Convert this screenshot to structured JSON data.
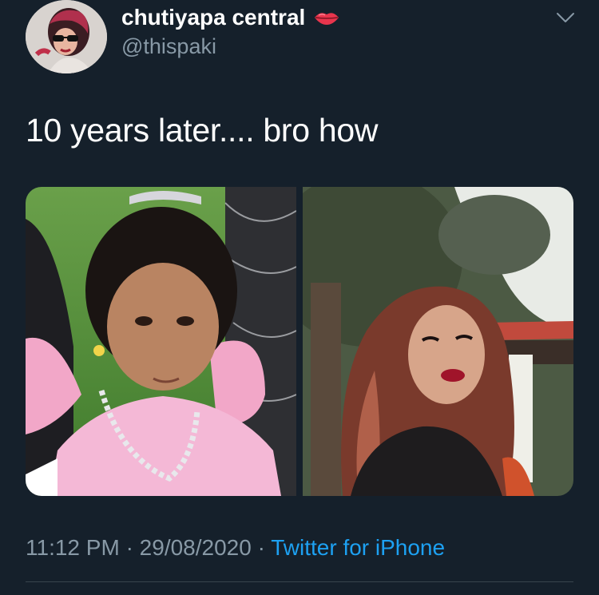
{
  "tweet": {
    "author": {
      "display_name": "chutiyapa central",
      "display_emoji": "lips-emoji",
      "handle": "@thispaki",
      "avatar_icon": "profile-avatar"
    },
    "menu_icon": "chevron-down-icon",
    "text": "10 years later.... bro how",
    "media": [
      {
        "description_icon": "photo-girl-fairy-costume"
      },
      {
        "description_icon": "photo-woman-red-hair"
      }
    ],
    "time": "11:12 PM",
    "separator": "·",
    "date": "29/08/2020",
    "source": "Twitter for iPhone"
  },
  "colors": {
    "background": "#15202b",
    "primary_text": "#ffffff",
    "secondary_text": "#8899a6",
    "link": "#1da1f2",
    "divider": "#38444d"
  }
}
